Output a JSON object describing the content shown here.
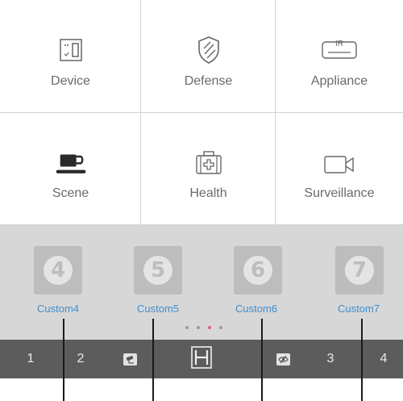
{
  "grid": {
    "items": [
      {
        "label": "Device",
        "icon": "device-icon"
      },
      {
        "label": "Defense",
        "icon": "shield-icon"
      },
      {
        "label": "Appliance",
        "icon": "ir-remote-icon",
        "icon_text": "IR"
      },
      {
        "label": "Scene",
        "icon": "coffee-cup-icon"
      },
      {
        "label": "Health",
        "icon": "medical-kit-icon"
      },
      {
        "label": "Surveillance",
        "icon": "video-camera-icon"
      }
    ]
  },
  "custom": {
    "items": [
      {
        "number": "4",
        "label": "Custom4"
      },
      {
        "number": "5",
        "label": "Custom5"
      },
      {
        "number": "6",
        "label": "Custom6"
      },
      {
        "number": "7",
        "label": "Custom7"
      }
    ],
    "page_indicator": {
      "total": 4,
      "active": 2
    }
  },
  "tabbar": {
    "tab1": "1",
    "tab2": "2",
    "camera_icon": "cctv-icon",
    "center_icon": "hotel-h-icon",
    "privacy_icon": "eye-off-icon",
    "tab3": "3",
    "tab4": "4"
  },
  "colors": {
    "custom_label": "#3f8fcf",
    "tabbar_bg": "#5c5c5c",
    "custom_bg": "#d7d7d7",
    "active_dot": "#e0607a"
  }
}
